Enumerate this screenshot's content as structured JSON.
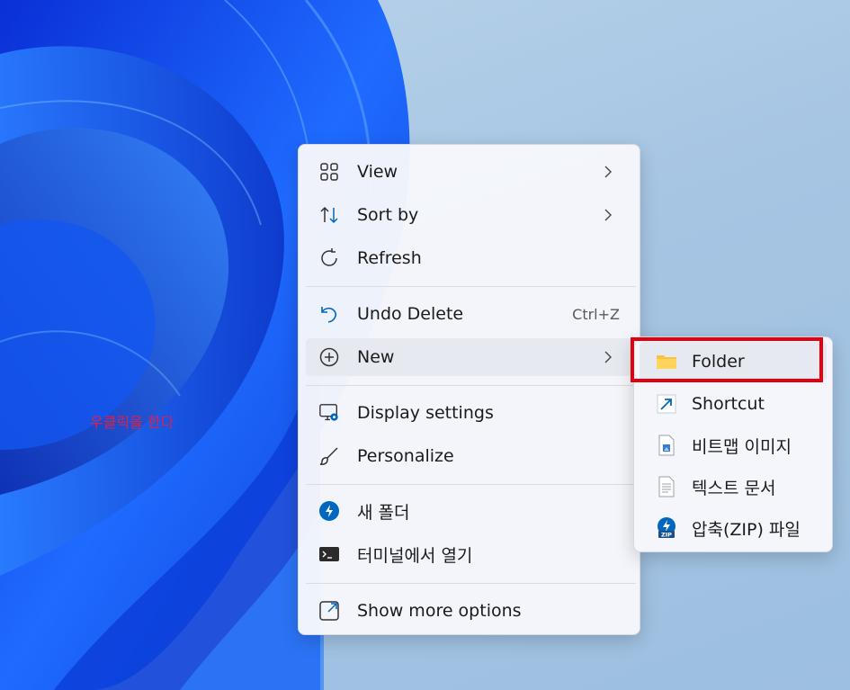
{
  "annotation_text": "우클릭을 한다",
  "accent_color": "#0067c0",
  "highlight_color": "#e3000f",
  "context_menu": {
    "items": [
      {
        "label": "View",
        "icon": "grid-icon",
        "has_submenu": true
      },
      {
        "label": "Sort by",
        "icon": "sort-arrows-icon",
        "has_submenu": true
      },
      {
        "label": "Refresh",
        "icon": "refresh-icon",
        "has_submenu": false
      },
      {
        "label": "Undo Delete",
        "icon": "undo-icon",
        "accelerator": "Ctrl+Z"
      },
      {
        "label": "New",
        "icon": "plus-circle-icon",
        "has_submenu": true,
        "active": true
      },
      {
        "label": "Display settings",
        "icon": "display-settings-icon"
      },
      {
        "label": "Personalize",
        "icon": "brush-icon"
      },
      {
        "label": "새 폴더",
        "icon": "blue-bolt-icon"
      },
      {
        "label": "터미널에서 열기",
        "icon": "terminal-icon"
      },
      {
        "label": "Show more options",
        "icon": "open-external-icon"
      }
    ]
  },
  "new_submenu": {
    "items": [
      {
        "label": "Folder",
        "icon": "folder-icon",
        "highlighted": true
      },
      {
        "label": "Shortcut",
        "icon": "shortcut-arrow-icon"
      },
      {
        "label": "비트맵 이미지",
        "icon": "bitmap-file-icon"
      },
      {
        "label": "텍스트 문서",
        "icon": "text-document-icon"
      },
      {
        "label": "압축(ZIP) 파일",
        "icon": "zip-file-icon"
      }
    ]
  }
}
